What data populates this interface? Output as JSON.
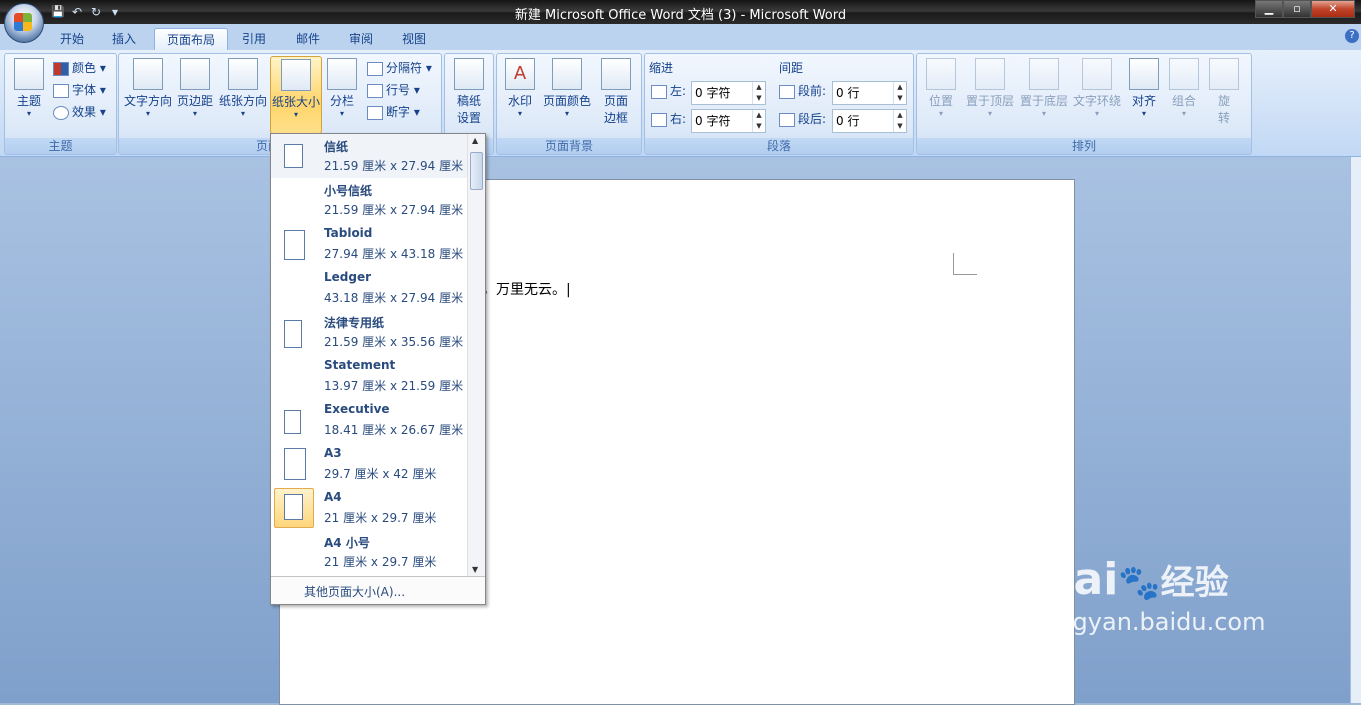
{
  "window": {
    "title": "新建 Microsoft Office Word 文档 (3) - Microsoft Word",
    "minimize": "▁",
    "maximize": "▫",
    "close": "✕"
  },
  "qat": {
    "save": "💾",
    "undo": "↶",
    "redo": "↻",
    "more": "▾"
  },
  "tabs": [
    "开始",
    "插入",
    "页面布局",
    "引用",
    "邮件",
    "审阅",
    "视图"
  ],
  "help": "?",
  "ribbon": {
    "themes": {
      "label": "主题",
      "main": "主题",
      "colors": "颜色",
      "fonts": "字体",
      "effects": "效果"
    },
    "page_setup": {
      "label": "页面设置",
      "orientation": "文字方向",
      "margins": "页边距",
      "paper_orient": "纸张方向",
      "size": "纸张大小",
      "columns": "分栏",
      "breaks": "分隔符",
      "line_numbers": "行号",
      "hyphenation": "断字"
    },
    "draft": {
      "label": "稿纸",
      "setup_line1": "稿纸",
      "setup_line2": "设置"
    },
    "background": {
      "label": "页面背景",
      "watermark": "水印",
      "color": "页面颜色",
      "border_line1": "页面",
      "border_line2": "边框"
    },
    "paragraph": {
      "label": "段落",
      "indent": "缩进",
      "left": "左:",
      "right": "右:",
      "left_val": "0 字符",
      "right_val": "0 字符",
      "spacing": "间距",
      "before": "段前:",
      "after": "段后:",
      "before_val": "0 行",
      "after_val": "0 行"
    },
    "arrange": {
      "label": "排列",
      "position": "位置",
      "front": "置于顶层",
      "back": "置于底层",
      "wrap": "文字环绕",
      "align": "对齐",
      "group": "组合",
      "rotate_line1": "旋",
      "rotate_line2": "转"
    }
  },
  "dropdown": {
    "items": [
      {
        "name": "信纸",
        "size": "21.59 厘米 x 27.94 厘米"
      },
      {
        "name": "小号信纸",
        "size": "21.59 厘米 x 27.94 厘米"
      },
      {
        "name": "Tabloid",
        "size": "27.94 厘米 x 43.18 厘米"
      },
      {
        "name": "Ledger",
        "size": "43.18 厘米 x 27.94 厘米"
      },
      {
        "name": "法律专用纸",
        "size": "21.59 厘米 x 35.56 厘米"
      },
      {
        "name": "Statement",
        "size": "13.97 厘米 x 21.59 厘米"
      },
      {
        "name": "Executive",
        "size": "18.41 厘米 x 26.67 厘米"
      },
      {
        "name": "A3",
        "size": "29.7 厘米 x 42 厘米"
      },
      {
        "name": "A4",
        "size": "21 厘米 x 29.7 厘米"
      },
      {
        "name": "A4 小号",
        "size": "21 厘米 x 29.7 厘米"
      }
    ],
    "footer": "其他页面大小(A)..."
  },
  "document": {
    "text": "今天天气晴朗，万里无云。"
  },
  "watermark": {
    "brand": "Bai",
    "brand2": "经验",
    "url": "jingyan.baidu.com"
  }
}
